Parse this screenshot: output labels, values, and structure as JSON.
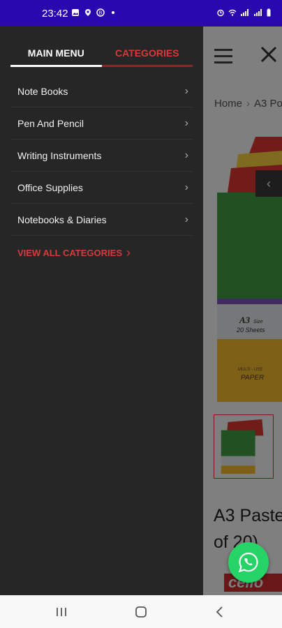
{
  "status_bar": {
    "time": "23:42",
    "left_icons": [
      "image-icon",
      "location-icon",
      "app-icon",
      "dot-icon"
    ],
    "right_icons": [
      "alarm-icon",
      "wifi-icon",
      "signal-icon",
      "signal-icon",
      "battery-icon"
    ]
  },
  "drawer": {
    "tabs": [
      {
        "label": "MAIN MENU"
      },
      {
        "label": "CATEGORIES"
      }
    ],
    "items": [
      {
        "label": "Note Books"
      },
      {
        "label": "Pen And Pencil"
      },
      {
        "label": "Writing Instruments"
      },
      {
        "label": "Office Supplies"
      },
      {
        "label": "Notebooks & Diaries"
      }
    ],
    "view_all": "VIEW ALL CATEGORIES"
  },
  "background_page": {
    "breadcrumb_home": "Home",
    "breadcrumb_current": "A3 Po",
    "product_title": "A3 Paste of 20)",
    "product_title_line1": "A3 Paste",
    "product_title_line2": "of 20)",
    "pack_size": "A3",
    "pack_size_suffix": "Size",
    "sheets": "20 Sheets",
    "paper_label_1": "MULTI - USE",
    "paper_label_2": "PAPER",
    "brand": "cello"
  },
  "colors": {
    "status_bar": "#2a08b0",
    "drawer_bg": "#262626",
    "accent_red": "#d63a3a",
    "whatsapp": "#25d366"
  }
}
